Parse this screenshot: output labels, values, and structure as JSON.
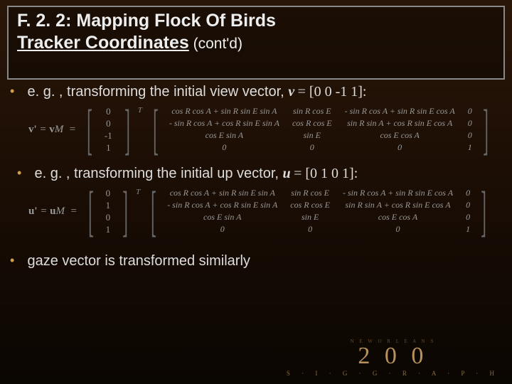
{
  "title": {
    "line1_prefix": "F. 2. 2: ",
    "line1_main": "Mapping Flock Of Birds",
    "line2_main": "Tracker Coordinates",
    "line2_suffix": " (cont'd)"
  },
  "bullets": {
    "b1_text": "e. g. , transforming the initial view vector, ",
    "b1_vec": "v",
    "b1_eq": " = [0 0 -1 1]:",
    "b2_text": "e. g. , transforming the initial up vector, ",
    "b2_vec": "u",
    "b2_eq": " = [0 1 0 1]:",
    "b3_text": "gaze vector is transformed similarly"
  },
  "matrix1": {
    "lhs": "v' = vM  =",
    "col": [
      "0",
      "0",
      "-1",
      "1"
    ],
    "m": [
      "cos R cos A + sin R sin E sin A",
      "sin R cos E",
      "- sin R cos A + sin R sin E cos A",
      "0",
      "- sin R cos A + cos R sin E sin A",
      "cos R cos E",
      "sin R sin A + cos R sin E cos A",
      "0",
      "cos E sin A",
      "sin E",
      "cos E cos A",
      "0",
      "0",
      "0",
      "0",
      "1"
    ]
  },
  "matrix2": {
    "lhs": "u' = uM  =",
    "col": [
      "0",
      "1",
      "0",
      "1"
    ],
    "m": [
      "cos R cos A + sin R sin E sin A",
      "sin R cos E",
      "- sin R cos A + sin R sin E cos A",
      "0",
      "- sin R cos A + cos R sin E sin A",
      "cos R cos E",
      "sin R sin A + cos R sin E cos A",
      "0",
      "cos E sin A",
      "sin E",
      "cos E cos A",
      "0",
      "0",
      "0",
      "0",
      "1"
    ]
  },
  "footer": {
    "city": "N E W   O R L E A N S",
    "year": "2 0 0",
    "brand": "S · I · G · G · R · A · P · H"
  }
}
